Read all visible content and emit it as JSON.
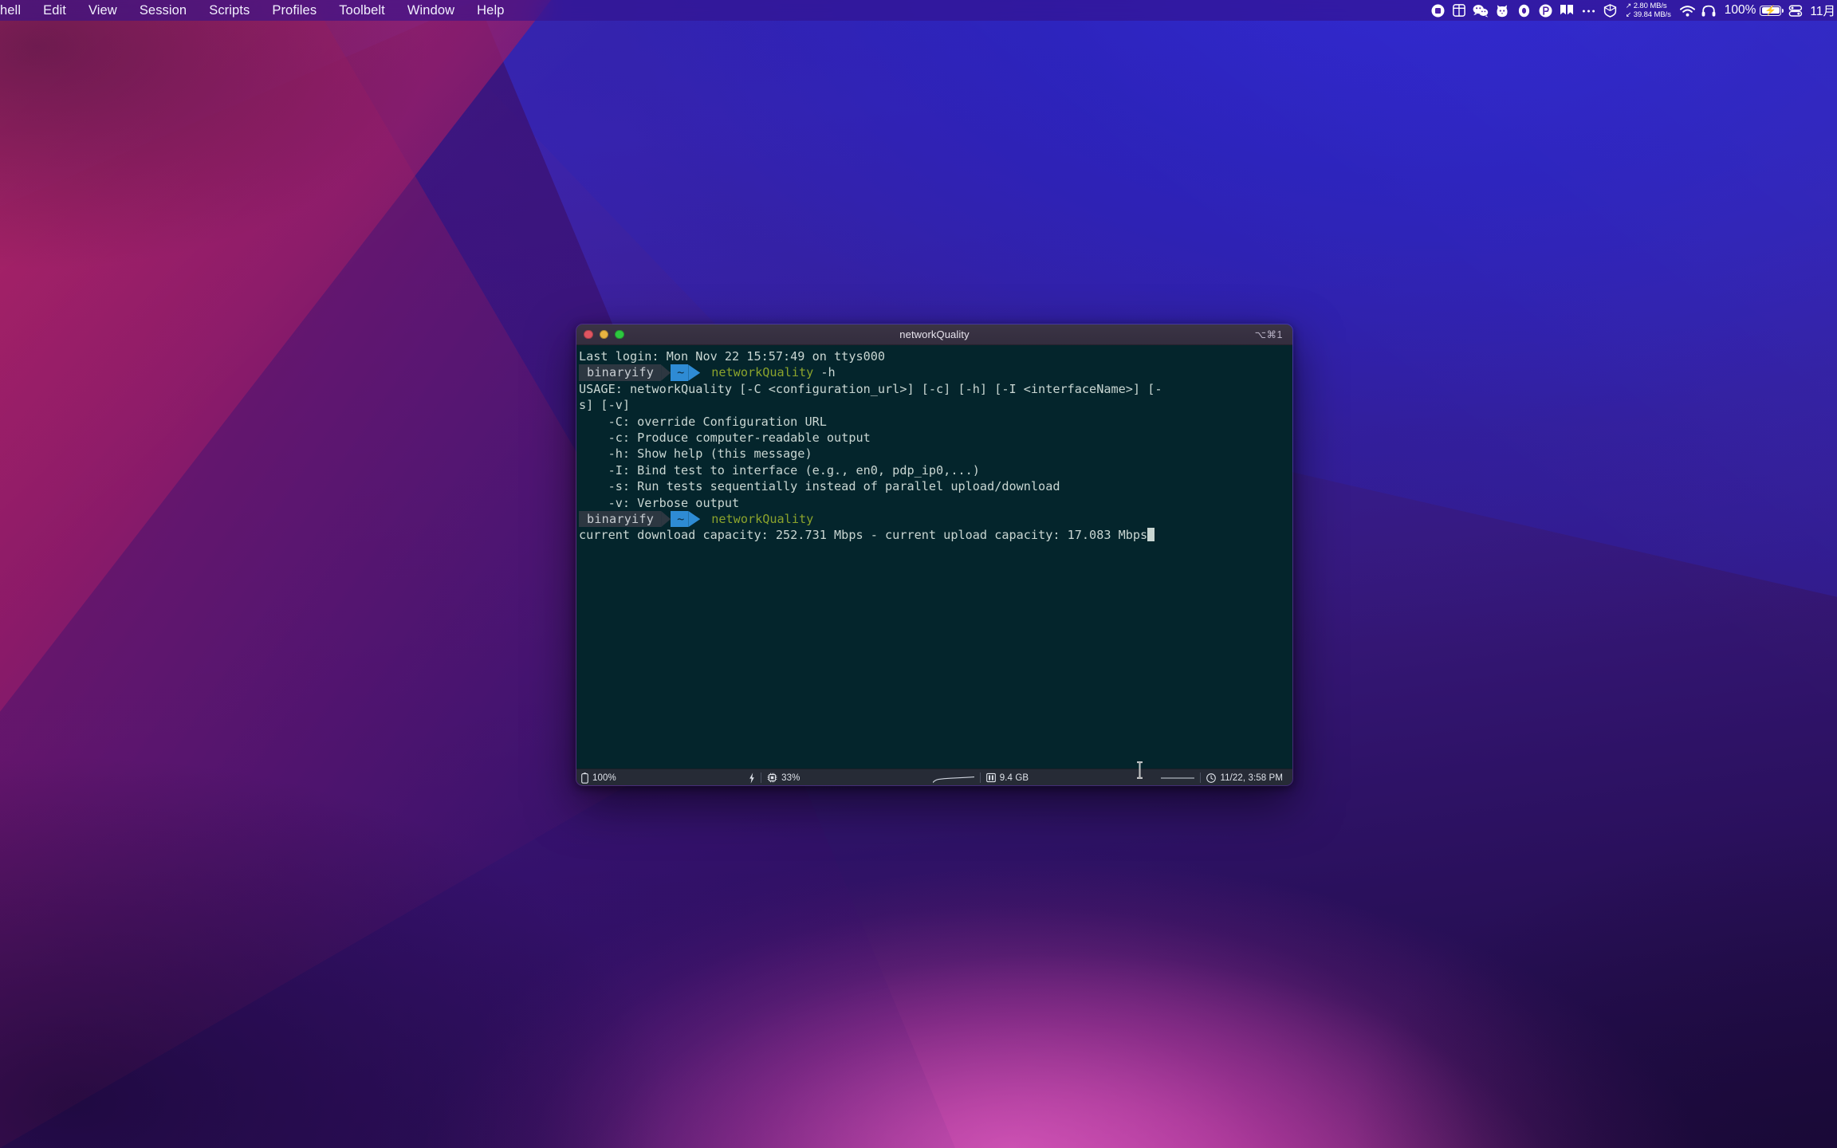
{
  "menubar": {
    "app_menus": [
      {
        "label": "hell",
        "name": "menu-shell"
      },
      {
        "label": "Edit",
        "name": "menu-edit"
      },
      {
        "label": "View",
        "name": "menu-view"
      },
      {
        "label": "Session",
        "name": "menu-session"
      },
      {
        "label": "Scripts",
        "name": "menu-scripts"
      },
      {
        "label": "Profiles",
        "name": "menu-profiles"
      },
      {
        "label": "Toolbelt",
        "name": "menu-toolbelt"
      },
      {
        "label": "Window",
        "name": "menu-window"
      },
      {
        "label": "Help",
        "name": "menu-help"
      }
    ],
    "tray_icons": [
      "record-circle-icon",
      "window-frame-icon",
      "wechat-icon",
      "cat-app-icon",
      "oval-app-icon",
      "pixelmator-p-icon",
      "bookmarks-icon",
      "ellipsis-icon",
      "shield-box-icon"
    ],
    "network": {
      "up_arrow": "↗",
      "up_value": "2.80 MB/s",
      "down_arrow": "↙",
      "down_value": "39.84 MB/s"
    },
    "wifi_icon": "wifi-icon",
    "headphones_icon": "headphones-icon",
    "battery": {
      "percent": "100%",
      "charging_icon": "lightning-bolt-icon"
    },
    "control_center_icon": "control-center-icon",
    "clock": "11月"
  },
  "window": {
    "title": "networkQuality",
    "shortcut": "⌥⌘1",
    "traffic_lights": {
      "close": "close-button",
      "minimize": "minimize-button",
      "maximize": "maximize-button"
    }
  },
  "terminal": {
    "login_line": "Last login: Mon Nov 22 15:57:49 on ttys000",
    "prompt": {
      "user": "binaryify",
      "path": "~"
    },
    "command_1": "networkQuality",
    "command_1_args": " -h",
    "usage_line_1": "USAGE: networkQuality [-C <configuration_url>] [-c] [-h] [-I <interfaceName>] [-",
    "usage_line_2": "s] [-v]",
    "options": [
      "    -C: override Configuration URL",
      "    -c: Produce computer-readable output",
      "    -h: Show help (this message)",
      "    -I: Bind test to interface (e.g., en0, pdp_ip0,...)",
      "    -s: Run tests sequentially instead of parallel upload/download",
      "    -v: Verbose output"
    ],
    "command_2": "networkQuality",
    "result_line": "current download capacity: 252.731 Mbps - current upload capacity: 17.083 Mbps",
    "colors": {
      "background": "#04252c",
      "foreground": "#c9d6d2",
      "command_green": "#8ba32c",
      "prompt_user_bg": "#2d3741",
      "prompt_path_bg": "#2e8bd4"
    }
  },
  "status_bar": {
    "battery_icon": "battery-icon",
    "battery_percent": "100%",
    "charging_icon": "lightning-bolt-icon",
    "cpu_icon": "cpu-chip-icon",
    "cpu_percent": "33%",
    "cpu_sparkline_icon": "cpu-sparkline",
    "memory_icon": "memory-icon",
    "memory_value": "9.4 GB",
    "memory_sparkline_icon": "memory-sparkline",
    "clock_icon": "clock-icon",
    "clock_value": "11/22, 3:58 PM"
  },
  "cursor": {
    "type": "i-beam-text-cursor"
  }
}
